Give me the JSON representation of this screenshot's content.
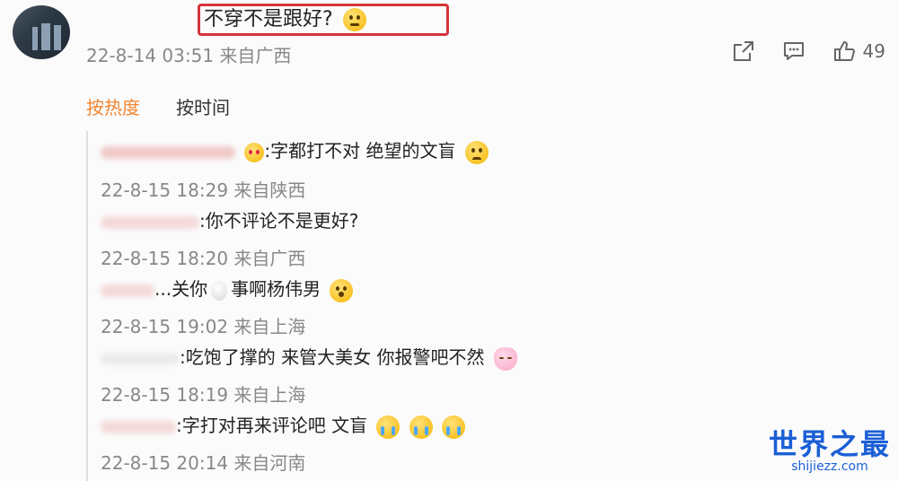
{
  "comment": {
    "text": "不穿不是跟好?",
    "timestamp": "22-8-14 03:51",
    "location": "来自广西",
    "like_count": "49"
  },
  "sort": {
    "hot_label": "按热度",
    "time_label": "按时间"
  },
  "replies": [
    {
      "prefix": "",
      "text": ":字都打不对 绝望的文盲",
      "timestamp": "22-8-15 18:29",
      "location": "来自陕西"
    },
    {
      "prefix": "",
      "text": ":你不评论不是更好?",
      "timestamp": "22-8-15 18:20",
      "location": "来自广西"
    },
    {
      "prefix": "",
      "text_a": "...关你",
      "text_b": "事啊杨伟男",
      "timestamp": "22-8-15 19:02",
      "location": "来自上海"
    },
    {
      "prefix": "",
      "text": ":吃饱了撑的 来管大美女 你报警吧不然",
      "timestamp": "22-8-15 18:19",
      "location": "来自上海"
    },
    {
      "prefix": "",
      "text": ":字打对再来评论吧 文盲",
      "timestamp": "22-8-15 20:14",
      "location": "来自河南"
    }
  ],
  "watermark": {
    "brand": "世界之最",
    "domain": "shijiezz.com"
  },
  "colors": {
    "accent": "#f28633",
    "highlight_border": "#d4343a",
    "watermark": "#1b5fd6"
  }
}
